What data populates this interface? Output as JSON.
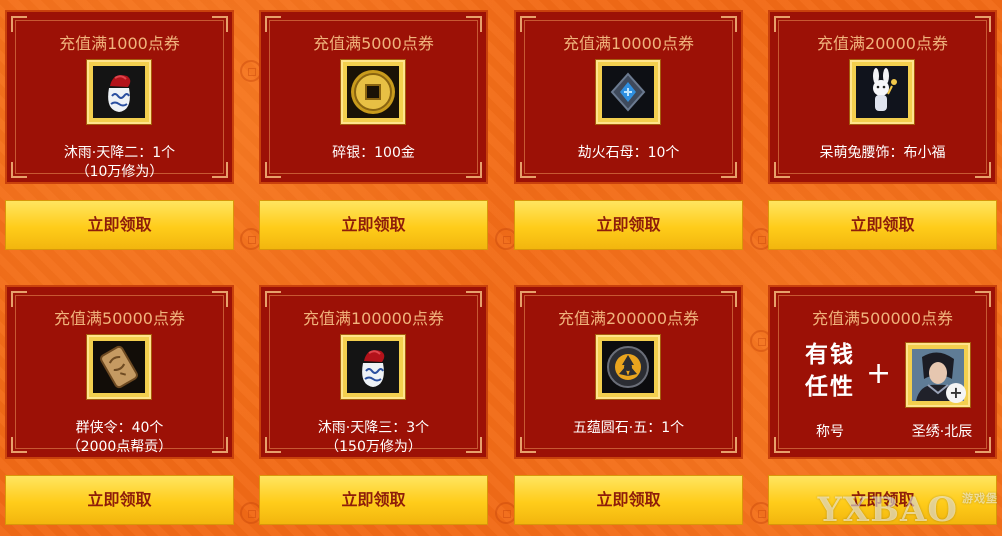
{
  "rewards": [
    {
      "title": "充值满1000点券",
      "icon": "wine-jar-icon",
      "lines": [
        "沐雨·天降二：1个",
        "（10万修为）"
      ],
      "button": "立即领取"
    },
    {
      "title": "充值满5000点券",
      "icon": "gold-coin-icon",
      "lines": [
        "碎银：100金"
      ],
      "button": "立即领取"
    },
    {
      "title": "充值满10000点券",
      "icon": "crystal-stone-icon",
      "lines": [
        "劫火石母：10个"
      ],
      "button": "立即领取"
    },
    {
      "title": "充值满20000点券",
      "icon": "rabbit-pendant-icon",
      "lines": [
        "呆萌兔腰饰：布小福"
      ],
      "button": "立即领取"
    },
    {
      "title": "充值满50000点券",
      "icon": "token-plaque-icon",
      "lines": [
        "群侠令：40个",
        "（2000点帮贡）"
      ],
      "button": "立即领取"
    },
    {
      "title": "充值满100000点券",
      "icon": "wine-jar-icon",
      "lines": [
        "沐雨·天降三：3个",
        "（150万修为）"
      ],
      "button": "立即领取"
    },
    {
      "title": "充值满200000点券",
      "icon": "five-elements-stone-icon",
      "lines": [
        "五蕴圆石·五：1个"
      ],
      "button": "立即领取"
    },
    {
      "title": "充值满500000点券",
      "icon": "character-portrait-icon",
      "special": {
        "calligraphy": "有钱任性",
        "plus": "+",
        "left_label": "称号",
        "right_label": "圣绣·北辰",
        "frame_plus": "+"
      },
      "button": "立即领取"
    }
  ],
  "watermark": {
    "text": "YXBAO",
    "sub": "游戏堡"
  }
}
